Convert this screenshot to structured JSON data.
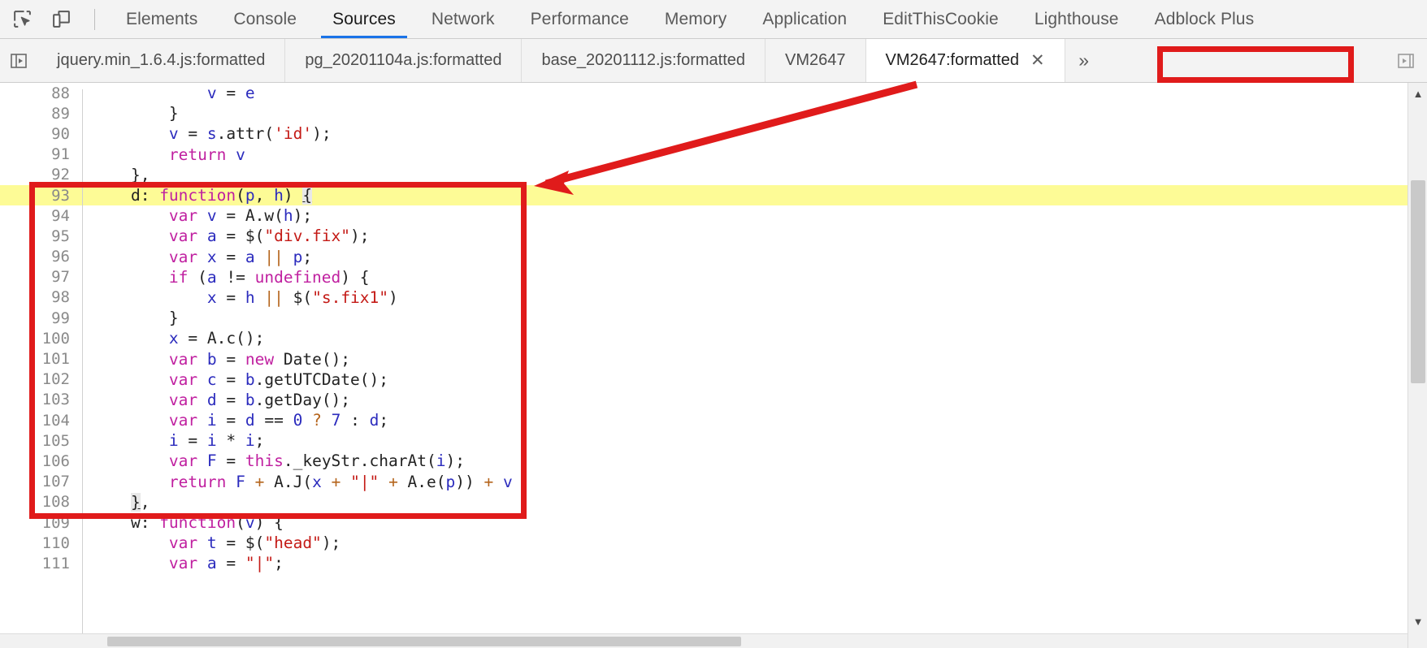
{
  "devtools": {
    "icons": [
      {
        "name": "inspect-element-icon",
        "label": "Inspect element"
      },
      {
        "name": "device-toolbar-icon",
        "label": "Toggle device toolbar"
      }
    ],
    "panel_tabs": [
      {
        "label": "Elements",
        "active": false
      },
      {
        "label": "Console",
        "active": false
      },
      {
        "label": "Sources",
        "active": true
      },
      {
        "label": "Network",
        "active": false
      },
      {
        "label": "Performance",
        "active": false
      },
      {
        "label": "Memory",
        "active": false
      },
      {
        "label": "Application",
        "active": false
      },
      {
        "label": "EditThisCookie",
        "active": false
      },
      {
        "label": "Lighthouse",
        "active": false
      },
      {
        "label": "Adblock Plus",
        "active": false
      }
    ],
    "active_panel": "Sources"
  },
  "file_tabs": {
    "navigator_toggle_icon": "show-navigator-icon",
    "items": [
      {
        "label": "jquery.min_1.6.4.js:formatted",
        "active": false,
        "closable": false
      },
      {
        "label": "pg_20201104a.js:formatted",
        "active": false,
        "closable": false
      },
      {
        "label": "base_20201112.js:formatted",
        "active": false,
        "closable": false
      },
      {
        "label": "VM2647",
        "active": false,
        "closable": false
      },
      {
        "label": "VM2647:formatted",
        "active": true,
        "closable": true,
        "close_glyph": "✕"
      }
    ],
    "overflow_glyph": "»",
    "right_toggle_icon": "show-debugger-sidebar-icon"
  },
  "editor": {
    "highlighted_line": 93,
    "first_visible_line": 88,
    "lines": [
      {
        "num": 88,
        "tokens": [
          {
            "t": "            ",
            "c": "pl"
          },
          {
            "t": "v",
            "c": "var"
          },
          {
            "t": " = ",
            "c": "pl"
          },
          {
            "t": "e",
            "c": "var"
          }
        ]
      },
      {
        "num": 89,
        "tokens": [
          {
            "t": "        }",
            "c": "pl"
          }
        ]
      },
      {
        "num": 90,
        "tokens": [
          {
            "t": "        ",
            "c": "pl"
          },
          {
            "t": "v",
            "c": "var"
          },
          {
            "t": " = ",
            "c": "pl"
          },
          {
            "t": "s",
            "c": "var"
          },
          {
            "t": ".attr(",
            "c": "pl"
          },
          {
            "t": "'id'",
            "c": "str"
          },
          {
            "t": ");",
            "c": "pl"
          }
        ]
      },
      {
        "num": 91,
        "tokens": [
          {
            "t": "        ",
            "c": "pl"
          },
          {
            "t": "return",
            "c": "kw"
          },
          {
            "t": " ",
            "c": "pl"
          },
          {
            "t": "v",
            "c": "var"
          }
        ]
      },
      {
        "num": 92,
        "tokens": [
          {
            "t": "    },",
            "c": "pl"
          }
        ]
      },
      {
        "num": 93,
        "tokens": [
          {
            "t": "    d: ",
            "c": "pl"
          },
          {
            "t": "function",
            "c": "kw"
          },
          {
            "t": "(",
            "c": "pl"
          },
          {
            "t": "p",
            "c": "var"
          },
          {
            "t": ", ",
            "c": "pl"
          },
          {
            "t": "h",
            "c": "var"
          },
          {
            "t": ") ",
            "c": "pl"
          },
          {
            "t": "{",
            "c": "brk"
          }
        ]
      },
      {
        "num": 94,
        "tokens": [
          {
            "t": "        ",
            "c": "pl"
          },
          {
            "t": "var",
            "c": "kw"
          },
          {
            "t": " ",
            "c": "pl"
          },
          {
            "t": "v",
            "c": "var"
          },
          {
            "t": " = A.w(",
            "c": "pl"
          },
          {
            "t": "h",
            "c": "var"
          },
          {
            "t": ");",
            "c": "pl"
          }
        ]
      },
      {
        "num": 95,
        "tokens": [
          {
            "t": "        ",
            "c": "pl"
          },
          {
            "t": "var",
            "c": "kw"
          },
          {
            "t": " ",
            "c": "pl"
          },
          {
            "t": "a",
            "c": "var"
          },
          {
            "t": " = $(",
            "c": "pl"
          },
          {
            "t": "\"div.fix\"",
            "c": "str"
          },
          {
            "t": ");",
            "c": "pl"
          }
        ]
      },
      {
        "num": 96,
        "tokens": [
          {
            "t": "        ",
            "c": "pl"
          },
          {
            "t": "var",
            "c": "kw"
          },
          {
            "t": " ",
            "c": "pl"
          },
          {
            "t": "x",
            "c": "var"
          },
          {
            "t": " = ",
            "c": "pl"
          },
          {
            "t": "a",
            "c": "var"
          },
          {
            "t": " ",
            "c": "pl"
          },
          {
            "t": "||",
            "c": "op"
          },
          {
            "t": " ",
            "c": "pl"
          },
          {
            "t": "p",
            "c": "var"
          },
          {
            "t": ";",
            "c": "pl"
          }
        ]
      },
      {
        "num": 97,
        "tokens": [
          {
            "t": "        ",
            "c": "pl"
          },
          {
            "t": "if",
            "c": "kw"
          },
          {
            "t": " (",
            "c": "pl"
          },
          {
            "t": "a",
            "c": "var"
          },
          {
            "t": " != ",
            "c": "pl"
          },
          {
            "t": "undefined",
            "c": "kw"
          },
          {
            "t": ") {",
            "c": "pl"
          }
        ]
      },
      {
        "num": 98,
        "tokens": [
          {
            "t": "            ",
            "c": "pl"
          },
          {
            "t": "x",
            "c": "var"
          },
          {
            "t": " = ",
            "c": "pl"
          },
          {
            "t": "h",
            "c": "var"
          },
          {
            "t": " ",
            "c": "pl"
          },
          {
            "t": "||",
            "c": "op"
          },
          {
            "t": " $(",
            "c": "pl"
          },
          {
            "t": "\"s.fix1\"",
            "c": "str"
          },
          {
            "t": ")",
            "c": "pl"
          }
        ]
      },
      {
        "num": 99,
        "tokens": [
          {
            "t": "        }",
            "c": "pl"
          }
        ]
      },
      {
        "num": 100,
        "tokens": [
          {
            "t": "        ",
            "c": "pl"
          },
          {
            "t": "x",
            "c": "var"
          },
          {
            "t": " = A.c();",
            "c": "pl"
          }
        ]
      },
      {
        "num": 101,
        "tokens": [
          {
            "t": "        ",
            "c": "pl"
          },
          {
            "t": "var",
            "c": "kw"
          },
          {
            "t": " ",
            "c": "pl"
          },
          {
            "t": "b",
            "c": "var"
          },
          {
            "t": " = ",
            "c": "pl"
          },
          {
            "t": "new",
            "c": "kw"
          },
          {
            "t": " Date();",
            "c": "pl"
          }
        ]
      },
      {
        "num": 102,
        "tokens": [
          {
            "t": "        ",
            "c": "pl"
          },
          {
            "t": "var",
            "c": "kw"
          },
          {
            "t": " ",
            "c": "pl"
          },
          {
            "t": "c",
            "c": "var"
          },
          {
            "t": " = ",
            "c": "pl"
          },
          {
            "t": "b",
            "c": "var"
          },
          {
            "t": ".getUTCDate();",
            "c": "pl"
          }
        ]
      },
      {
        "num": 103,
        "tokens": [
          {
            "t": "        ",
            "c": "pl"
          },
          {
            "t": "var",
            "c": "kw"
          },
          {
            "t": " ",
            "c": "pl"
          },
          {
            "t": "d",
            "c": "var"
          },
          {
            "t": " = ",
            "c": "pl"
          },
          {
            "t": "b",
            "c": "var"
          },
          {
            "t": ".getDay();",
            "c": "pl"
          }
        ]
      },
      {
        "num": 104,
        "tokens": [
          {
            "t": "        ",
            "c": "pl"
          },
          {
            "t": "var",
            "c": "kw"
          },
          {
            "t": " ",
            "c": "pl"
          },
          {
            "t": "i",
            "c": "var"
          },
          {
            "t": " = ",
            "c": "pl"
          },
          {
            "t": "d",
            "c": "var"
          },
          {
            "t": " == ",
            "c": "pl"
          },
          {
            "t": "0",
            "c": "num"
          },
          {
            "t": " ",
            "c": "pl"
          },
          {
            "t": "?",
            "c": "op"
          },
          {
            "t": " ",
            "c": "pl"
          },
          {
            "t": "7",
            "c": "num"
          },
          {
            "t": " : ",
            "c": "pl"
          },
          {
            "t": "d",
            "c": "var"
          },
          {
            "t": ";",
            "c": "pl"
          }
        ]
      },
      {
        "num": 105,
        "tokens": [
          {
            "t": "        ",
            "c": "pl"
          },
          {
            "t": "i",
            "c": "var"
          },
          {
            "t": " = ",
            "c": "pl"
          },
          {
            "t": "i",
            "c": "var"
          },
          {
            "t": " * ",
            "c": "pl"
          },
          {
            "t": "i",
            "c": "var"
          },
          {
            "t": ";",
            "c": "pl"
          }
        ]
      },
      {
        "num": 106,
        "tokens": [
          {
            "t": "        ",
            "c": "pl"
          },
          {
            "t": "var",
            "c": "kw"
          },
          {
            "t": " ",
            "c": "pl"
          },
          {
            "t": "F",
            "c": "var"
          },
          {
            "t": " = ",
            "c": "pl"
          },
          {
            "t": "this",
            "c": "kw"
          },
          {
            "t": "._keyStr.charAt(",
            "c": "pl"
          },
          {
            "t": "i",
            "c": "var"
          },
          {
            "t": ");",
            "c": "pl"
          }
        ]
      },
      {
        "num": 107,
        "tokens": [
          {
            "t": "        ",
            "c": "pl"
          },
          {
            "t": "return",
            "c": "kw"
          },
          {
            "t": " ",
            "c": "pl"
          },
          {
            "t": "F",
            "c": "var"
          },
          {
            "t": " ",
            "c": "pl"
          },
          {
            "t": "+",
            "c": "op"
          },
          {
            "t": " A.J(",
            "c": "pl"
          },
          {
            "t": "x",
            "c": "var"
          },
          {
            "t": " ",
            "c": "pl"
          },
          {
            "t": "+",
            "c": "op"
          },
          {
            "t": " ",
            "c": "pl"
          },
          {
            "t": "\"|\"",
            "c": "str"
          },
          {
            "t": " ",
            "c": "pl"
          },
          {
            "t": "+",
            "c": "op"
          },
          {
            "t": " A.e(",
            "c": "pl"
          },
          {
            "t": "p",
            "c": "var"
          },
          {
            "t": ")) ",
            "c": "pl"
          },
          {
            "t": "+",
            "c": "op"
          },
          {
            "t": " ",
            "c": "pl"
          },
          {
            "t": "v",
            "c": "var"
          }
        ]
      },
      {
        "num": 108,
        "tokens": [
          {
            "t": "    ",
            "c": "pl"
          },
          {
            "t": "}",
            "c": "brk"
          },
          {
            "t": ",",
            "c": "pl"
          }
        ]
      },
      {
        "num": 109,
        "tokens": [
          {
            "t": "    w: ",
            "c": "pl"
          },
          {
            "t": "function",
            "c": "kw"
          },
          {
            "t": "(",
            "c": "pl"
          },
          {
            "t": "v",
            "c": "var"
          },
          {
            "t": ") {",
            "c": "pl"
          }
        ]
      },
      {
        "num": 110,
        "tokens": [
          {
            "t": "        ",
            "c": "pl"
          },
          {
            "t": "var",
            "c": "kw"
          },
          {
            "t": " ",
            "c": "pl"
          },
          {
            "t": "t",
            "c": "var"
          },
          {
            "t": " = $(",
            "c": "pl"
          },
          {
            "t": "\"head\"",
            "c": "str"
          },
          {
            "t": ");",
            "c": "pl"
          }
        ]
      },
      {
        "num": 111,
        "tokens": [
          {
            "t": "        ",
            "c": "pl"
          },
          {
            "t": "var",
            "c": "kw"
          },
          {
            "t": " ",
            "c": "pl"
          },
          {
            "t": "a",
            "c": "var"
          },
          {
            "t": " = ",
            "c": "pl"
          },
          {
            "t": "\"|\"",
            "c": "str"
          },
          {
            "t": ";",
            "c": "pl"
          }
        ]
      }
    ]
  },
  "annotations": {
    "accent_color": "#e01b1b",
    "highlight_color": "#fdfb96",
    "boxes": [
      {
        "name": "code-block-callout",
        "target": "lines 93-108"
      },
      {
        "name": "active-tab-callout",
        "target": "VM2647:formatted"
      }
    ],
    "arrow": {
      "name": "callout-arrow",
      "from_tab": "VM2647:formatted",
      "to_line": 93
    }
  }
}
